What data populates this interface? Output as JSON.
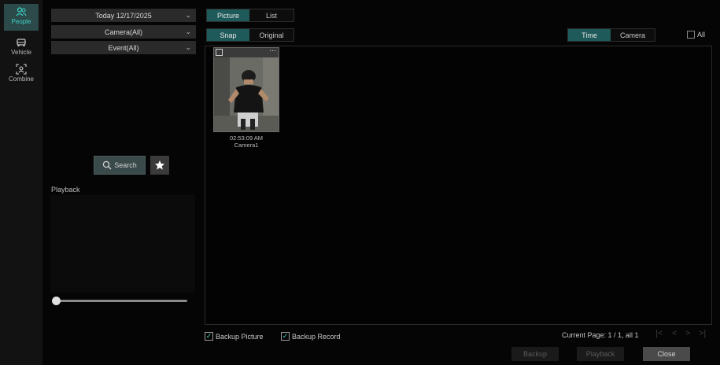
{
  "rail": {
    "items": [
      {
        "label": "People",
        "icon": "people-icon",
        "active": true
      },
      {
        "label": "Vehicle",
        "icon": "vehicle-icon",
        "active": false
      },
      {
        "label": "Combine",
        "icon": "combine-icon",
        "active": false
      }
    ]
  },
  "filters": {
    "date": "Today 12/17/2025",
    "camera": "Camera(All)",
    "event": "Event(All)"
  },
  "search": {
    "label": "Search"
  },
  "playback": {
    "label": "Playback",
    "progress": 0
  },
  "view_tabs": {
    "picture": "Picture",
    "list": "List",
    "selected": "Picture"
  },
  "image_tabs": {
    "snap": "Snap",
    "original": "Original",
    "selected": "Snap"
  },
  "sort_tabs": {
    "time": "Time",
    "camera": "Camera",
    "selected": "Time"
  },
  "select_all": {
    "label": "All",
    "checked": false
  },
  "results": [
    {
      "time": "02:53:09 AM",
      "camera": "Camera1",
      "checked": false
    }
  ],
  "backup_options": {
    "picture": {
      "label": "Backup Picture",
      "checked": true
    },
    "record": {
      "label": "Backup Record",
      "checked": true
    }
  },
  "pagination": {
    "text": "Current Page: 1 / 1, all 1"
  },
  "actions": {
    "backup": "Backup",
    "playback": "Playback",
    "close": "Close"
  },
  "colors": {
    "accent": "#1f5a5a",
    "accent_text": "#3fd0c4",
    "background": "#050505"
  }
}
